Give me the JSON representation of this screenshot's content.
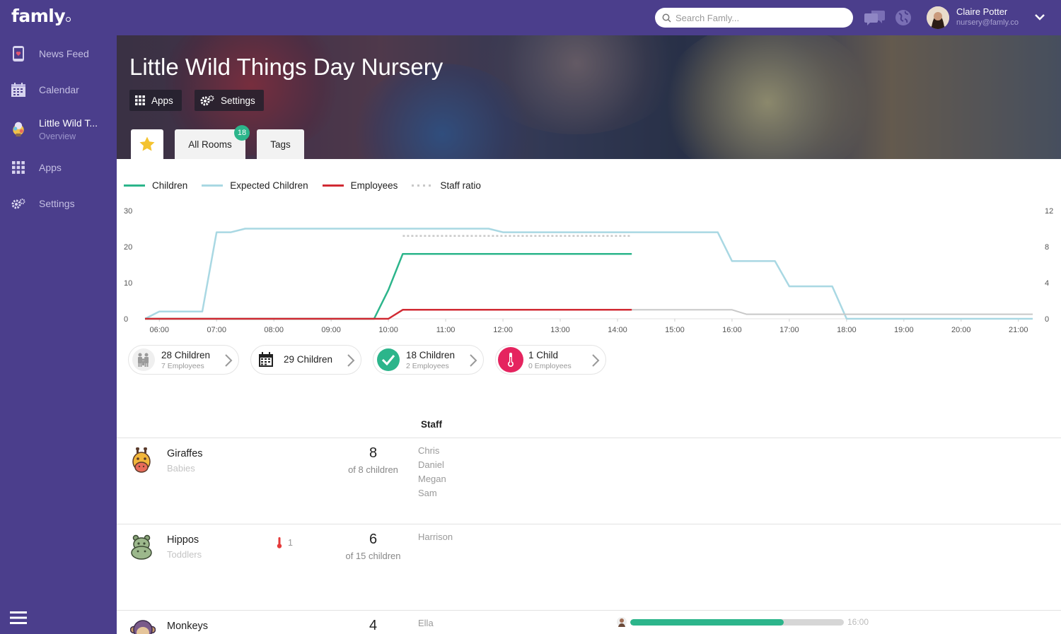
{
  "app": {
    "logo": "famly"
  },
  "header": {
    "search_placeholder": "Search Famly...",
    "user_name": "Claire Potter",
    "user_email": "nursery@famly.co"
  },
  "sidebar": {
    "items": [
      {
        "label": "News Feed",
        "icon": "news-feed-icon"
      },
      {
        "label": "Calendar",
        "icon": "calendar-icon"
      },
      {
        "label": "Little Wild T...",
        "sub": "Overview",
        "icon": "nursery-icon"
      },
      {
        "label": "Apps",
        "icon": "apps-icon"
      },
      {
        "label": "Settings",
        "icon": "settings-icon"
      }
    ]
  },
  "hero": {
    "title": "Little Wild Things Day Nursery",
    "apps_label": "Apps",
    "settings_label": "Settings",
    "tabs": [
      {
        "label": "",
        "icon": "star-icon"
      },
      {
        "label": "All Rooms",
        "badge": "18"
      },
      {
        "label": "Tags"
      }
    ]
  },
  "colors": {
    "brand": "#4b3e8c",
    "children": "#2cb58b",
    "expected": "#a9d8e3",
    "employees": "#d12a33",
    "ratio": "#c8c8c8"
  },
  "chart_data": {
    "type": "line",
    "legend": [
      {
        "name": "Children",
        "style": "solid"
      },
      {
        "name": "Expected Children",
        "style": "solid"
      },
      {
        "name": "Employees",
        "style": "solid"
      },
      {
        "name": "Staff ratio",
        "style": "dotted"
      }
    ],
    "x_ticks": [
      "06:00",
      "07:00",
      "08:00",
      "09:00",
      "10:00",
      "11:00",
      "12:00",
      "13:00",
      "14:00",
      "15:00",
      "16:00",
      "17:00",
      "18:00",
      "19:00",
      "20:00",
      "21:00"
    ],
    "xlim": [
      "05:45",
      "21:15"
    ],
    "y_left_ticks": [
      "0",
      "10",
      "20",
      "30"
    ],
    "y_left_lim": [
      0,
      30
    ],
    "y_right_ticks": [
      "0",
      "4",
      "8",
      "12"
    ],
    "y_right_lim": [
      0,
      12
    ],
    "series": [
      {
        "name": "Children",
        "axis": "left",
        "x": [
          "05:45",
          "09:45",
          "10:00",
          "10:15",
          "14:15"
        ],
        "values": [
          0,
          0,
          8,
          18,
          18
        ]
      },
      {
        "name": "Expected Children",
        "axis": "left",
        "x": [
          "05:45",
          "06:00",
          "06:45",
          "07:00",
          "07:15",
          "07:30",
          "11:45",
          "12:00",
          "15:45",
          "16:00",
          "16:45",
          "17:00",
          "17:45",
          "18:00",
          "21:15"
        ],
        "values": [
          0,
          2,
          2,
          24,
          24,
          25,
          25,
          24,
          24,
          16,
          16,
          9,
          9,
          0,
          0
        ]
      },
      {
        "name": "Employees",
        "axis": "right",
        "x": [
          "05:45",
          "10:00",
          "10:15",
          "14:15"
        ],
        "values": [
          0,
          0,
          1,
          1
        ]
      },
      {
        "name": "Employees (scheduled)",
        "axis": "right",
        "x": [
          "14:15",
          "16:00",
          "16:15",
          "21:15"
        ],
        "values": [
          1,
          1,
          0.5,
          0.5
        ]
      },
      {
        "name": "Staff ratio",
        "axis": "right",
        "x": [
          "10:15",
          "14:15"
        ],
        "values": [
          9.2,
          9.2
        ]
      }
    ]
  },
  "summary": [
    {
      "line1": "28 Children",
      "line2": "7 Employees",
      "icon": "family-icon"
    },
    {
      "line1": "29 Children",
      "line2": "",
      "icon": "calendar-icon"
    },
    {
      "line1": "18 Children",
      "line2": "2 Employees",
      "icon": "check-icon"
    },
    {
      "line1": "1 Child",
      "line2": "0 Employees",
      "icon": "thermometer-icon"
    }
  ],
  "table": {
    "staff_header": "Staff",
    "rooms": [
      {
        "name": "Giraffes",
        "group": "Babies",
        "count": "8",
        "of": "of 8 children",
        "sick": "",
        "staff": [
          "Chris",
          "Daniel",
          "Megan",
          "Sam"
        ]
      },
      {
        "name": "Hippos",
        "group": "Toddlers",
        "count": "6",
        "of": "of 15 children",
        "sick": "1",
        "staff": [
          "Harrison"
        ]
      },
      {
        "name": "Monkeys",
        "group": "",
        "count": "4",
        "of": "",
        "sick": "",
        "staff": [
          "Ella"
        ]
      }
    ],
    "shift": {
      "progress": 0.72,
      "end_time": "16:00"
    }
  }
}
